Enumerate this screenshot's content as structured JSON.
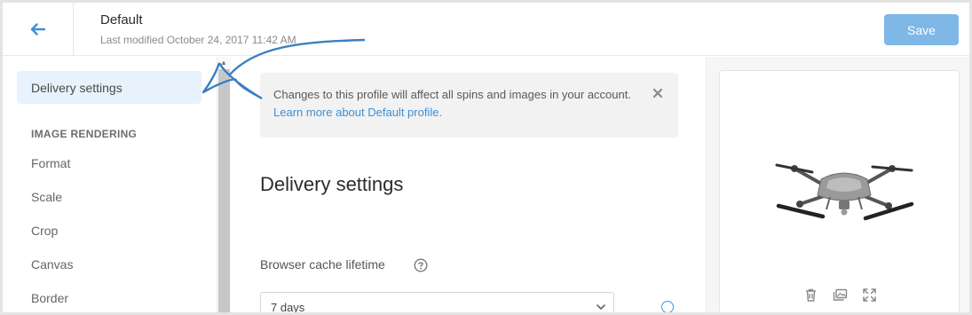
{
  "header": {
    "title": "Default",
    "subtitle": "Last modified October 24, 2017 11:42 AM",
    "save_label": "Save"
  },
  "sidebar": {
    "active_item": "Delivery settings",
    "section_heading": "IMAGE RENDERING",
    "items": [
      "Format",
      "Scale",
      "Crop",
      "Canvas",
      "Border"
    ]
  },
  "notice": {
    "text": "Changes to this profile will affect all spins and images in your account.",
    "link": "Learn more about Default profile."
  },
  "main": {
    "section_title": "Delivery settings",
    "field_label": "Browser cache lifetime",
    "select_value": "7 days"
  },
  "icons": {
    "back": "arrow-left-icon",
    "close": "close-icon",
    "help": "question-circle-icon",
    "chevron": "chevron-down-icon",
    "delete": "trash-icon",
    "image": "images-icon",
    "fullscreen": "expand-icon"
  },
  "colors": {
    "accent": "#3d8fd6",
    "save_button": "#7fb7e6",
    "active_item_bg": "#e8f2fc",
    "annotation_arrow": "#3a7fc1"
  }
}
